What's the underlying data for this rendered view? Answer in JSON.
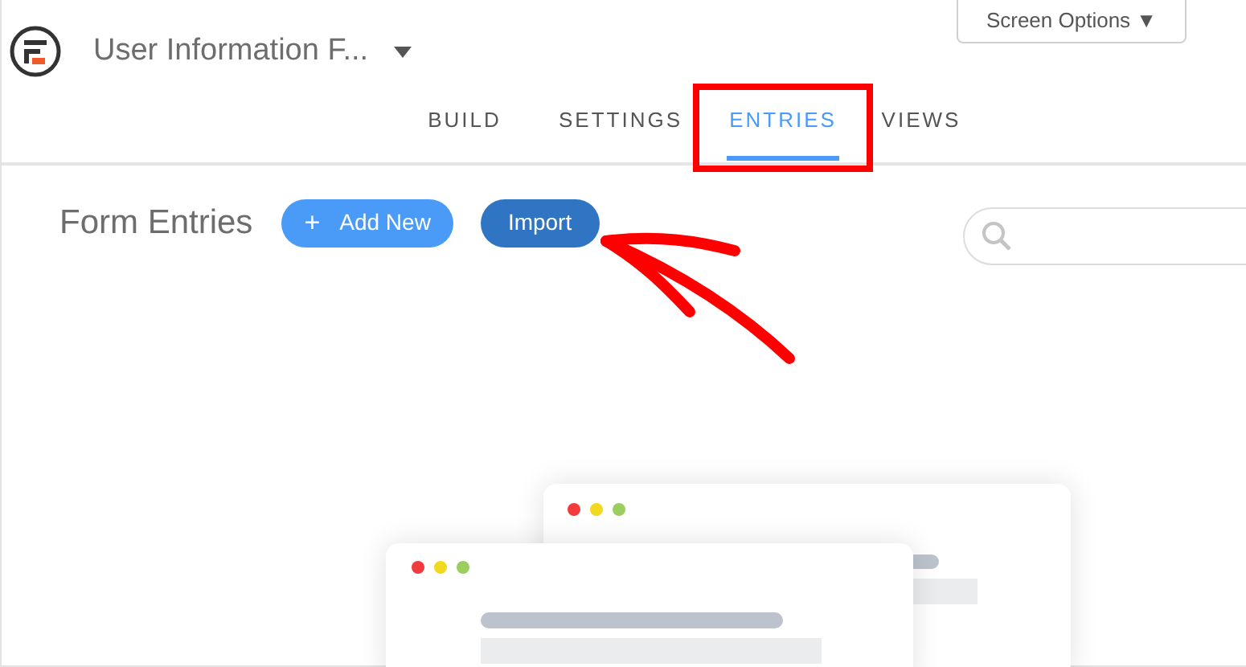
{
  "header": {
    "title": "User Information F...",
    "screen_options": "Screen Options ▼"
  },
  "tabs": [
    {
      "label": "BUILD",
      "selected": false,
      "highlighted": false
    },
    {
      "label": "SETTINGS",
      "selected": false,
      "highlighted": false
    },
    {
      "label": "ENTRIES",
      "selected": true,
      "highlighted": true
    },
    {
      "label": "VIEWS",
      "selected": false,
      "highlighted": false
    }
  ],
  "page": {
    "heading": "Form Entries",
    "buttons": [
      {
        "label": "Add New",
        "kind": "primary",
        "icon": "+"
      },
      {
        "label": "Import",
        "kind": "secondary"
      }
    ]
  }
}
